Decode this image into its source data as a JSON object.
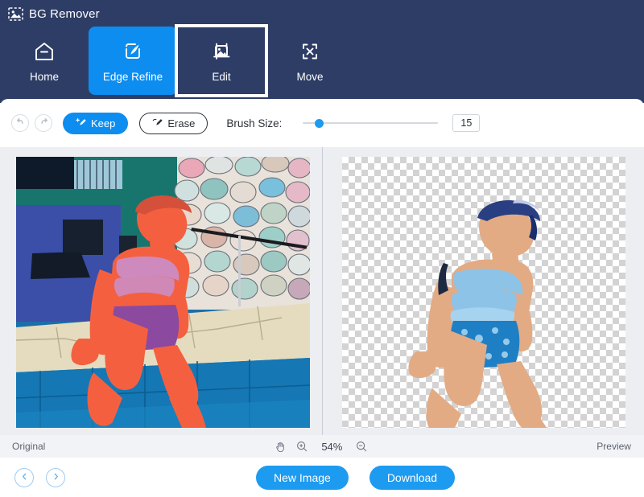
{
  "header": {
    "logo_icon": "image-placeholder-icon",
    "title": "BG Remover",
    "background_color": "#2e3d66",
    "accent_color": "#0d8df0",
    "nav": [
      {
        "label": "Home",
        "icon": "home-icon",
        "state": "default"
      },
      {
        "label": "Edge Refine",
        "icon": "pen-edit-icon",
        "state": "active"
      },
      {
        "label": "Edit",
        "icon": "crop-image-icon",
        "state": "highlighted"
      },
      {
        "label": "Move",
        "icon": "move-arrows-icon",
        "state": "default"
      }
    ]
  },
  "toolbar": {
    "undo_icon": "undo-arrow-icon",
    "redo_icon": "redo-arrow-icon",
    "keep_label": "Keep",
    "keep_icon": "brush-plus-icon",
    "erase_label": "Erase",
    "erase_icon": "brush-minus-icon",
    "brush_size_label": "Brush Size:",
    "brush_size_value": "15",
    "slider_fill_percent": 9
  },
  "canvas": {
    "left_panel_label": "Original",
    "right_panel_label": "Preview",
    "left_image_alt": "Toddler girl in blue swimsuit seated by a pool, subject masked in red",
    "right_image_alt": "Same toddler cut out on transparent checkerboard background"
  },
  "status": {
    "original_label": "Original",
    "pan_icon": "hand-pan-icon",
    "zoom_in_icon": "zoom-in-icon",
    "zoom_out_icon": "zoom-out-icon",
    "zoom_level": "54%",
    "preview_label": "Preview"
  },
  "footer": {
    "prev_icon": "chevron-left-icon",
    "next_icon": "chevron-right-icon",
    "new_image_label": "New Image",
    "download_label": "Download",
    "button_color": "#1d9bf0"
  }
}
